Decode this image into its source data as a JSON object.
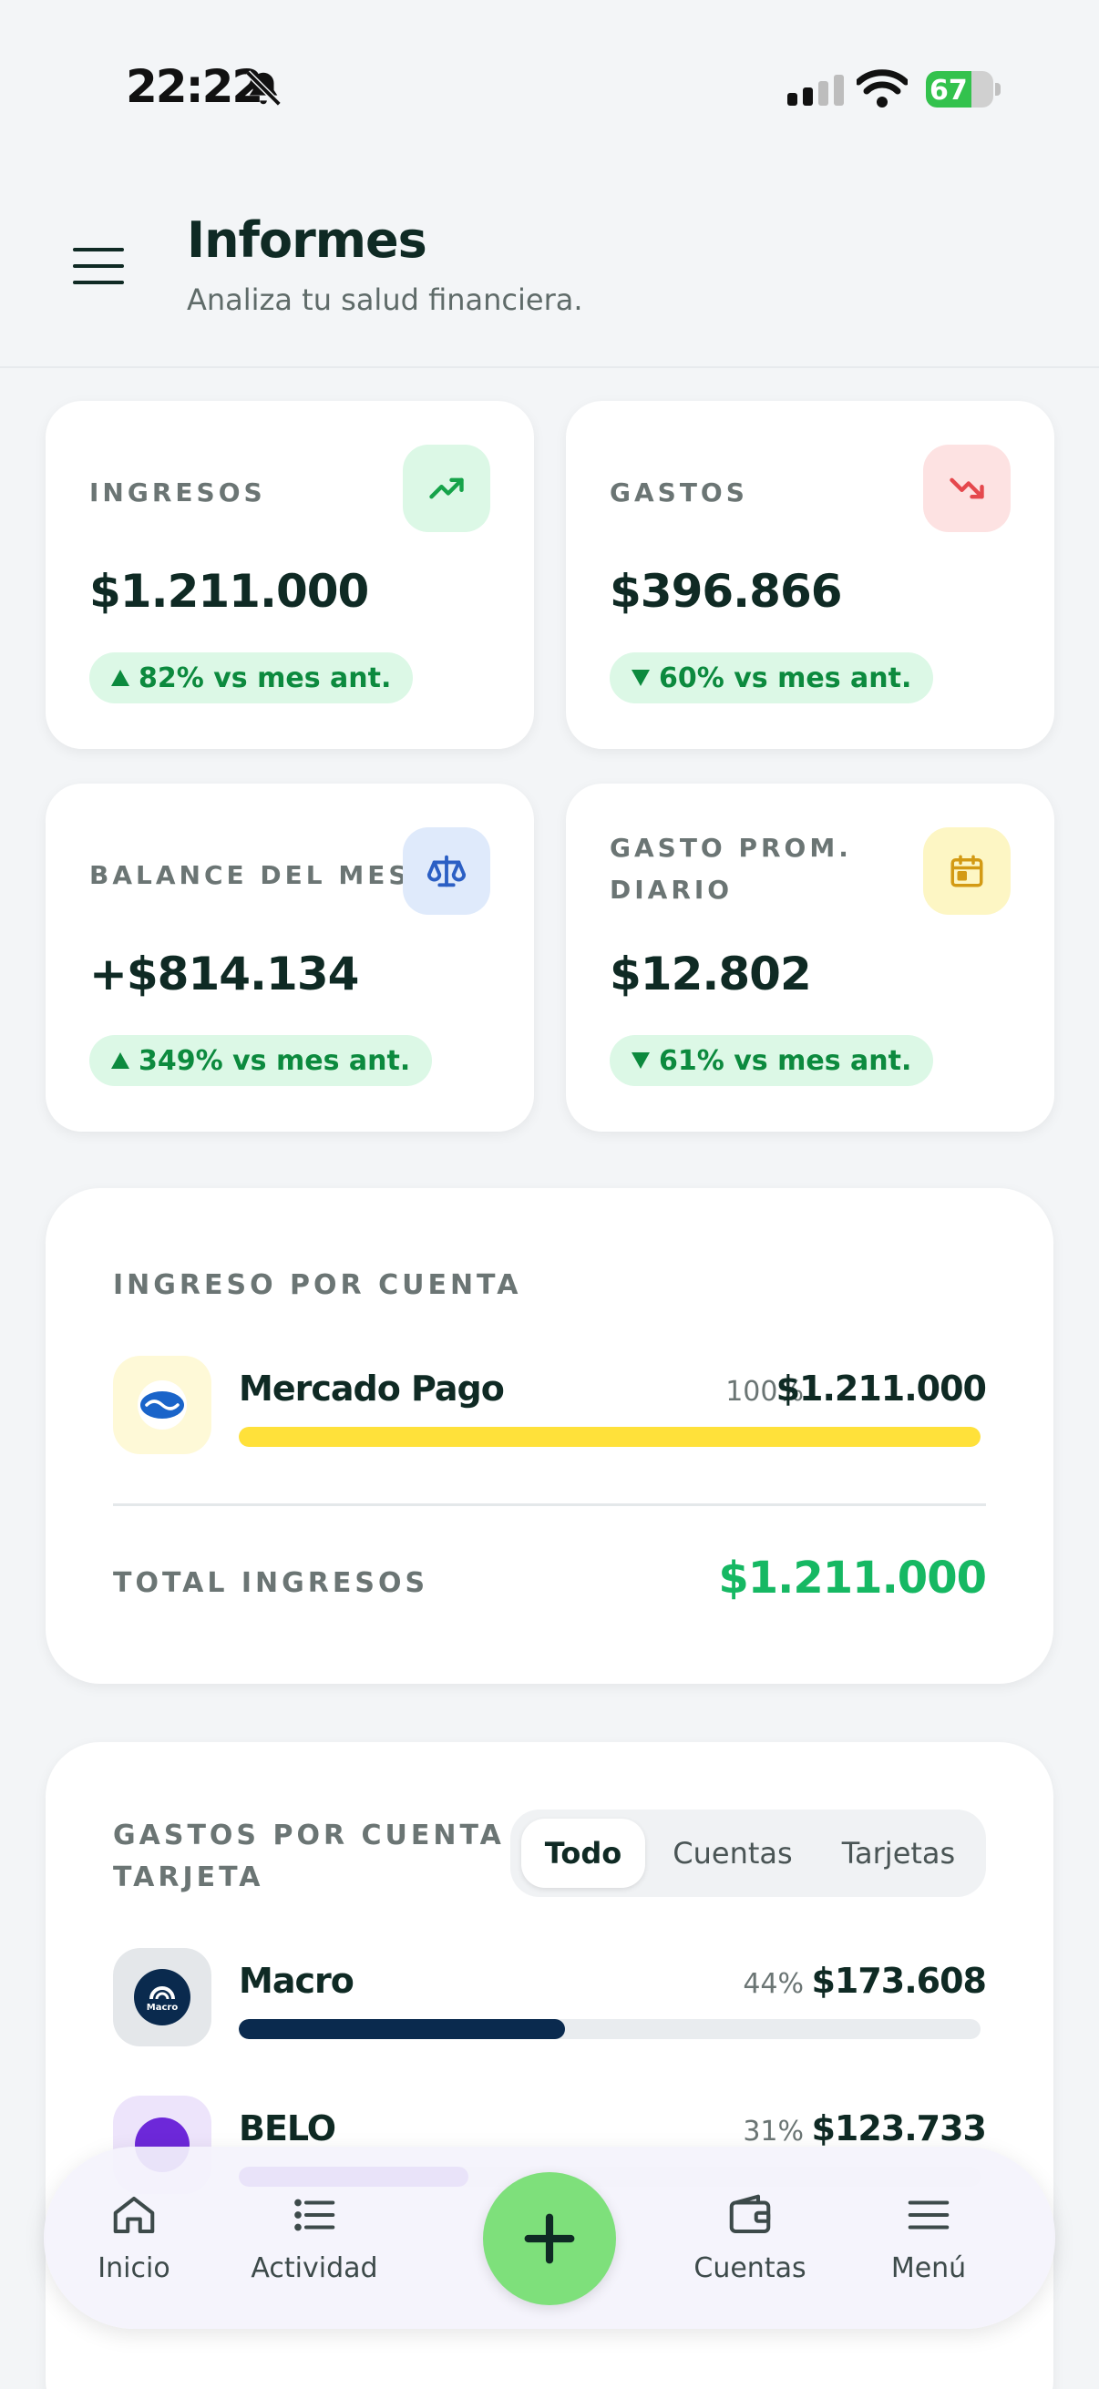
{
  "status_bar": {
    "time": "22:22",
    "battery": "67",
    "battery_level": 0.67
  },
  "header": {
    "title": "Informes",
    "subtitle": "Analiza tu salud financiera."
  },
  "kpis": [
    {
      "label": "INGRESOS",
      "value": "$1.211.000",
      "delta": "82% vs mes ant.",
      "direction": "up",
      "icon": "trending-up-icon",
      "icon_bg": "#dcf8e6",
      "icon_color": "#16a34a"
    },
    {
      "label": "GASTOS",
      "value": "$396.866",
      "delta": "60% vs mes ant.",
      "direction": "down",
      "icon": "trending-down-icon",
      "icon_bg": "#fde2e2",
      "icon_color": "#e5484d"
    },
    {
      "label": "BALANCE DEL MES",
      "value": "+$814.134",
      "delta": "349% vs mes ant.",
      "direction": "up",
      "icon": "scale-icon",
      "icon_bg": "#dfeafb",
      "icon_color": "#2b5fc4"
    },
    {
      "label_line1": "GASTO PROM.",
      "label_line2": "DIARIO",
      "value": "$12.802",
      "delta": "61% vs mes ant.",
      "direction": "down",
      "icon": "calendar-icon",
      "icon_bg": "#fdf6c4",
      "icon_color": "#d39a14"
    }
  ],
  "income_by_account": {
    "title": "INGRESO POR CUENTA",
    "rows": [
      {
        "name": "Mercado Pago",
        "pct": "100%",
        "amount": "$1.211.000",
        "fraction": 1.0,
        "bar_color": "#ffe13a",
        "logo": "mercado-pago-logo"
      }
    ],
    "total_label": "TOTAL INGRESOS",
    "total_value": "$1.211.000"
  },
  "expenses_by_account": {
    "title_line1": "GASTOS POR CUENTA /",
    "title_line2": "TARJETA",
    "tabs": [
      "Todo",
      "Cuentas",
      "Tarjetas"
    ],
    "active_tab": "Todo",
    "rows": [
      {
        "name": "Macro",
        "pct": "44%",
        "amount": "$173.608",
        "fraction": 0.44,
        "bar_color": "#0a2a4e",
        "logo": "macro-logo",
        "logo_text": "Macro"
      },
      {
        "name": "BELO",
        "pct": "31%",
        "amount": "$123.733",
        "fraction": 0.31,
        "bar_color": "#6d28d9",
        "logo": "belo-logo"
      }
    ]
  },
  "bottom_nav": {
    "items": [
      {
        "label": "Inicio",
        "icon": "home-icon"
      },
      {
        "label": "Actividad",
        "icon": "list-icon"
      },
      {
        "label": "Cuentas",
        "icon": "wallet-icon"
      },
      {
        "label": "Menú",
        "icon": "menu-icon"
      }
    ],
    "fab_icon": "plus-icon"
  }
}
